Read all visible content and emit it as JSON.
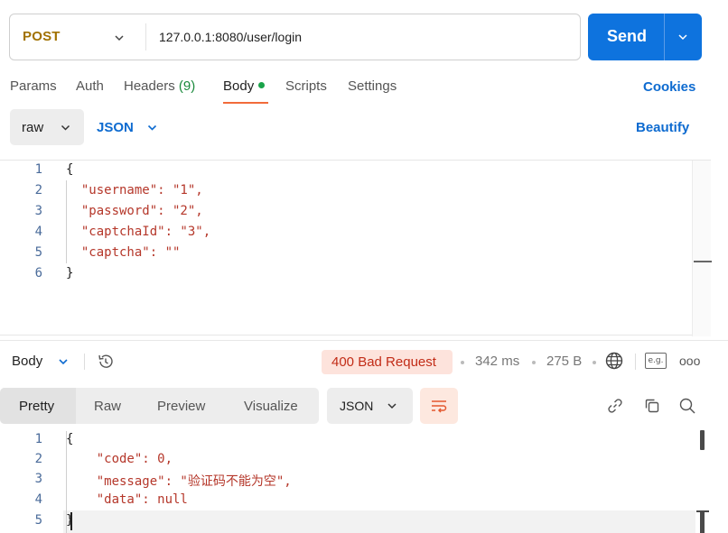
{
  "request": {
    "method": "POST",
    "url": "127.0.0.1:8080/user/login",
    "send_label": "Send"
  },
  "request_tabs": {
    "params": "Params",
    "auth": "Auth",
    "headers": "Headers",
    "headers_count": "(9)",
    "body": "Body",
    "scripts": "Scripts",
    "settings": "Settings",
    "cookies": "Cookies",
    "active": "Body"
  },
  "body_options": {
    "mode": "raw",
    "language": "JSON",
    "beautify": "Beautify"
  },
  "request_body": {
    "line_numbers": [
      "1",
      "2",
      "3",
      "4",
      "5",
      "6"
    ],
    "lines": [
      "{",
      "  \"username\": \"1\",",
      "  \"password\": \"2\",",
      "  \"captchaId\": \"3\",",
      "  \"captcha\": \"\"",
      "}"
    ]
  },
  "response": {
    "section_label": "Body",
    "status": "400 Bad Request",
    "time": "342 ms",
    "size": "275 B",
    "eg_label": "e.g.",
    "more": "ooo",
    "view_tabs": [
      "Pretty",
      "Raw",
      "Preview",
      "Visualize"
    ],
    "active_view": "Pretty",
    "format": "JSON",
    "line_numbers": [
      "1",
      "2",
      "3",
      "4",
      "5"
    ],
    "lines": [
      "{",
      "    \"code\": 0,",
      "    \"message\": \"验证码不能为空\",",
      "    \"data\": null",
      "}"
    ]
  },
  "colors": {
    "send_button": "#0e73de",
    "method_post": "#a17100",
    "status_error_bg": "#fde3dc",
    "status_error_text": "#c22c17",
    "link_blue": "#0e6bd0",
    "active_tab_underline": "#f26b3a",
    "json_key": "#b5372a",
    "json_string": "#1d4fb3"
  },
  "icons": {
    "method_dropdown": "chevron-down-icon",
    "send_dropdown": "chevron-down-icon",
    "history": "history-icon",
    "network": "globe-icon",
    "examples": "eg-icon",
    "more": "more-icon",
    "wrap": "wrap-lines-icon",
    "link": "link-icon",
    "copy": "copy-icon",
    "search": "search-icon"
  }
}
